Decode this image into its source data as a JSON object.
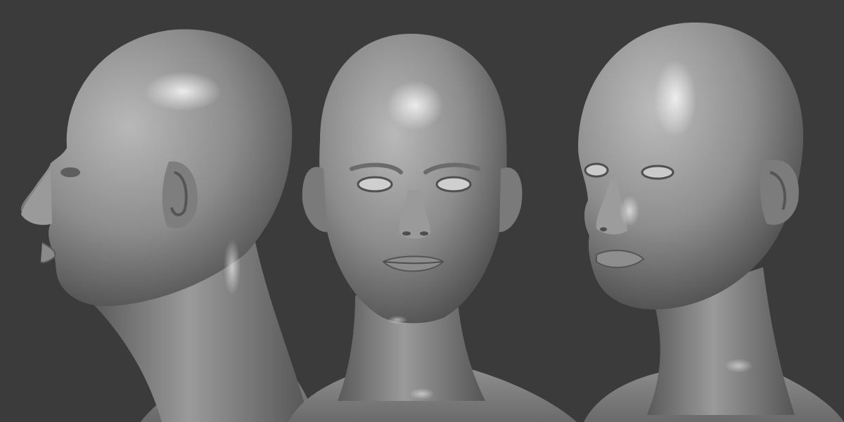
{
  "colors": {
    "background": "#3b3b3b",
    "clay_light": "#a6a6a6",
    "clay_mid": "#8a8a8a",
    "clay_dark": "#4c4c4c",
    "highlight": "#e2e2e2"
  },
  "views": [
    {
      "name": "side-profile-left"
    },
    {
      "name": "front"
    },
    {
      "name": "three-quarter-right"
    }
  ]
}
